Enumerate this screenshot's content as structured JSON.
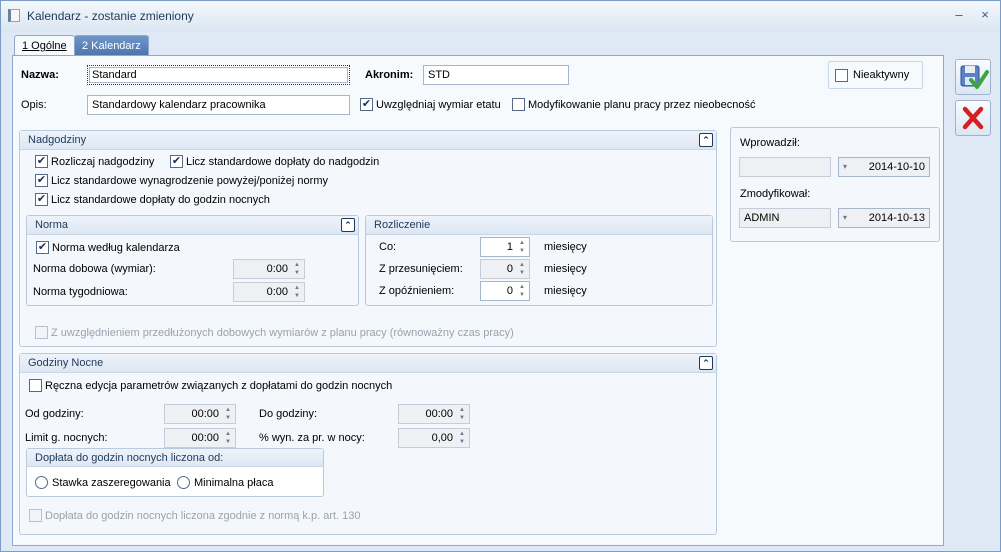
{
  "window": {
    "title": "Kalendarz - zostanie zmieniony",
    "min_label": "–",
    "close_label": "×"
  },
  "tabs": [
    {
      "label": "1 Ogólne"
    },
    {
      "label": "2 Kalendarz"
    }
  ],
  "header": {
    "nazwa_label": "Nazwa:",
    "nazwa_value": "Standard",
    "akronim_label": "Akronim:",
    "akronim_value": "STD",
    "nieaktywny_label": "Nieaktywny",
    "opis_label": "Opis:",
    "opis_value": "Standardowy kalendarz pracownika",
    "uwzgledniaj_label": "Uwzględniaj wymiar etatu",
    "modyfikowanie_label": "Modyfikowanie planu pracy przez nieobecność"
  },
  "nadgodziny": {
    "title": "Nadgodziny",
    "rozliczaj": "Rozliczaj nadgodziny",
    "dopłaty": "Licz standardowe dopłaty do nadgodzin",
    "wynagrodzenie": "Licz standardowe wynagrodzenie powyżej/poniżej  normy",
    "nocne": "Licz standardowe dopłaty do godzin nocnych",
    "norma": {
      "title": "Norma",
      "wedlug": "Norma według kalendarza",
      "dobowa_label": "Norma dobowa (wymiar):",
      "dobowa_value": "0:00",
      "tygodniowa_label": "Norma tygodniowa:",
      "tygodniowa_value": "0:00"
    },
    "rozliczenie": {
      "title": "Rozliczenie",
      "co_label": "Co:",
      "co_value": "1",
      "przesunieciem_label": "Z przesunięciem:",
      "przesunieciem_value": "0",
      "opoznieniem_label": "Z opóźnieniem:",
      "opoznieniem_value": "0",
      "unit": "miesięcy"
    },
    "przedluzonych": "Z uwzględnieniem przedłużonych dobowych wymiarów z planu pracy (równoważny czas pracy)"
  },
  "nocne": {
    "title": "Godziny Nocne",
    "reczna": "Ręczna edycja parametrów związanych z dopłatami do godzin nocnych",
    "od_label": "Od godziny:",
    "od_value": "00:00",
    "do_label": "Do godziny:",
    "do_value": "00:00",
    "limit_label": "Limit g. nocnych:",
    "limit_value": "00:00",
    "wyn_label": "% wyn. za pr. w nocy:",
    "wyn_value": "0,00",
    "doplata_group": "Dopłata do godzin nocnych liczona od:",
    "stawka": "Stawka zaszeregowania",
    "minimalna": "Minimalna płaca",
    "zgodnie": "Dopłata do godzin nocnych liczona zgodnie z normą k.p. art. 130"
  },
  "audit": {
    "wprowadzil_label": "Wprowadził:",
    "wprowadzil_user": "",
    "wprowadzil_date": "2014-10-10",
    "zmodyfikowal_label": "Zmodyfikował:",
    "zmodyfikowal_user": "ADMIN",
    "zmodyfikowal_date": "2014-10-13"
  },
  "checks": {
    "rozliczaj": true,
    "doplaty": true,
    "wynagrodzenie": true,
    "nocne": true,
    "wedlug": true,
    "uwzgledniaj": true,
    "nieaktywny": false,
    "modyfikowanie": false,
    "reczna": false,
    "przedluzonych": false,
    "zgodnie": false
  },
  "colors": {
    "accent": "#4a73ab",
    "title": "#1e395b",
    "save_green": "#3aa63a",
    "cancel_red": "#d42020"
  }
}
